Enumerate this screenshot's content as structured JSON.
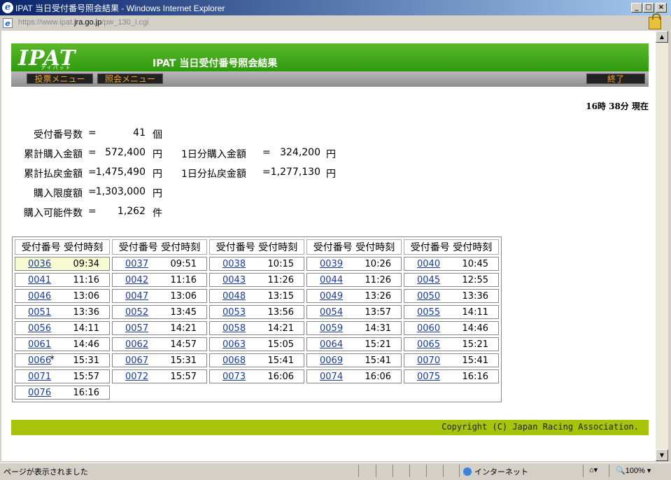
{
  "window": {
    "title": "IPAT  当日受付番号照会結果 - Windows Internet Explorer"
  },
  "address": {
    "url_dim1": "https://www.ipat.",
    "url_bold": "jra.go.jp",
    "url_dim2": "/pw_130_i.cgi"
  },
  "header": {
    "logo": "IPAT",
    "logo_sub": "アイパット",
    "title": "IPAT  当日受付番号照会結果"
  },
  "nav": {
    "vote_menu": "投票メニュー",
    "inquiry_menu": "照会メニュー",
    "exit": "終了"
  },
  "time_now": "16時 38分 現在",
  "summary": {
    "receipt_count_label": "受付番号数",
    "receipt_count": "41",
    "receipt_count_unit": "個",
    "total_purchase_label": "累計購入金額",
    "total_purchase": "572,400",
    "yen1": "円",
    "day_purchase_label": "1日分購入金額",
    "day_purchase": "324,200",
    "yen2": "円",
    "total_refund_label": "累計払戻金額",
    "total_refund": "1,475,490",
    "yen3": "円",
    "day_refund_label": "1日分払戻金額",
    "day_refund": "1,277,130",
    "yen4": "円",
    "limit_label": "購入限度額",
    "limit": "1,303,000",
    "yen5": "円",
    "available_label": "購入可能件数",
    "available": "1,262",
    "available_unit": "件",
    "eq": "="
  },
  "table": {
    "col_num": "受付番号",
    "col_time": "受付時刻",
    "rows": [
      [
        {
          "n": "0036",
          "t": "09:34"
        },
        {
          "n": "0037",
          "t": "09:51"
        },
        {
          "n": "0038",
          "t": "10:15"
        },
        {
          "n": "0039",
          "t": "10:26"
        },
        {
          "n": "0040",
          "t": "10:45"
        }
      ],
      [
        {
          "n": "0041",
          "t": "11:16"
        },
        {
          "n": "0042",
          "t": "11:16"
        },
        {
          "n": "0043",
          "t": "11:26"
        },
        {
          "n": "0044",
          "t": "11:26"
        },
        {
          "n": "0045",
          "t": "12:55"
        }
      ],
      [
        {
          "n": "0046",
          "t": "13:06"
        },
        {
          "n": "0047",
          "t": "13:06"
        },
        {
          "n": "0048",
          "t": "13:15"
        },
        {
          "n": "0049",
          "t": "13:26"
        },
        {
          "n": "0050",
          "t": "13:36"
        }
      ],
      [
        {
          "n": "0051",
          "t": "13:36"
        },
        {
          "n": "0052",
          "t": "13:45"
        },
        {
          "n": "0053",
          "t": "13:56"
        },
        {
          "n": "0054",
          "t": "13:57"
        },
        {
          "n": "0055",
          "t": "14:11"
        }
      ],
      [
        {
          "n": "0056",
          "t": "14:11"
        },
        {
          "n": "0057",
          "t": "14:21"
        },
        {
          "n": "0058",
          "t": "14:21"
        },
        {
          "n": "0059",
          "t": "14:31"
        },
        {
          "n": "0060",
          "t": "14:46"
        }
      ],
      [
        {
          "n": "0061",
          "t": "14:46"
        },
        {
          "n": "0062",
          "t": "14:57"
        },
        {
          "n": "0063",
          "t": "15:05"
        },
        {
          "n": "0064",
          "t": "15:21"
        },
        {
          "n": "0065",
          "t": "15:21"
        }
      ],
      [
        {
          "n": "0066",
          "t": "15:31",
          "mark": "*"
        },
        {
          "n": "0067",
          "t": "15:31"
        },
        {
          "n": "0068",
          "t": "15:41"
        },
        {
          "n": "0069",
          "t": "15:41"
        },
        {
          "n": "0070",
          "t": "15:41"
        }
      ],
      [
        {
          "n": "0071",
          "t": "15:57"
        },
        {
          "n": "0072",
          "t": "15:57"
        },
        {
          "n": "0073",
          "t": "16:06"
        },
        {
          "n": "0074",
          "t": "16:06"
        },
        {
          "n": "0075",
          "t": "16:16"
        }
      ],
      [
        {
          "n": "0076",
          "t": "16:16"
        }
      ]
    ]
  },
  "footer": {
    "copyright": "Copyright (C) Japan Racing Association."
  },
  "status": {
    "text": "ページが表示されました",
    "zone": "インターネット",
    "zoom": "100%"
  },
  "colors": {
    "banner_green": "#3fa41a",
    "footer_green": "#a8c40a",
    "nav_text": "#f5a623",
    "highlight_row": "#f6fbd2"
  }
}
